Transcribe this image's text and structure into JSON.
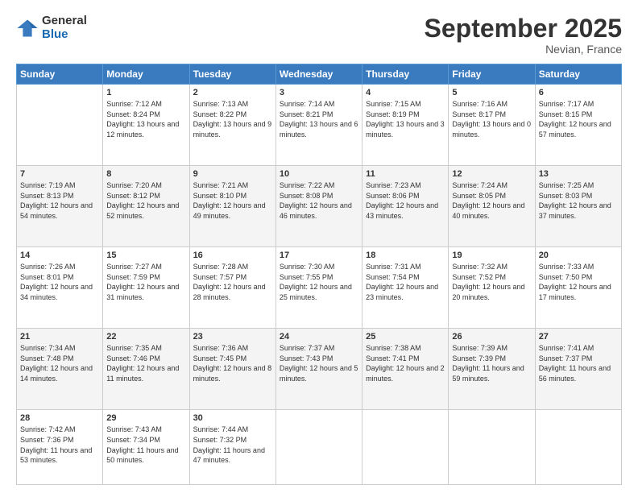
{
  "logo": {
    "general": "General",
    "blue": "Blue"
  },
  "header": {
    "month": "September 2025",
    "location": "Nevian, France"
  },
  "weekdays": [
    "Sunday",
    "Monday",
    "Tuesday",
    "Wednesday",
    "Thursday",
    "Friday",
    "Saturday"
  ],
  "weeks": [
    [
      {
        "day": "",
        "sunrise": "",
        "sunset": "",
        "daylight": ""
      },
      {
        "day": "1",
        "sunrise": "Sunrise: 7:12 AM",
        "sunset": "Sunset: 8:24 PM",
        "daylight": "Daylight: 13 hours and 12 minutes."
      },
      {
        "day": "2",
        "sunrise": "Sunrise: 7:13 AM",
        "sunset": "Sunset: 8:22 PM",
        "daylight": "Daylight: 13 hours and 9 minutes."
      },
      {
        "day": "3",
        "sunrise": "Sunrise: 7:14 AM",
        "sunset": "Sunset: 8:21 PM",
        "daylight": "Daylight: 13 hours and 6 minutes."
      },
      {
        "day": "4",
        "sunrise": "Sunrise: 7:15 AM",
        "sunset": "Sunset: 8:19 PM",
        "daylight": "Daylight: 13 hours and 3 minutes."
      },
      {
        "day": "5",
        "sunrise": "Sunrise: 7:16 AM",
        "sunset": "Sunset: 8:17 PM",
        "daylight": "Daylight: 13 hours and 0 minutes."
      },
      {
        "day": "6",
        "sunrise": "Sunrise: 7:17 AM",
        "sunset": "Sunset: 8:15 PM",
        "daylight": "Daylight: 12 hours and 57 minutes."
      }
    ],
    [
      {
        "day": "7",
        "sunrise": "Sunrise: 7:19 AM",
        "sunset": "Sunset: 8:13 PM",
        "daylight": "Daylight: 12 hours and 54 minutes."
      },
      {
        "day": "8",
        "sunrise": "Sunrise: 7:20 AM",
        "sunset": "Sunset: 8:12 PM",
        "daylight": "Daylight: 12 hours and 52 minutes."
      },
      {
        "day": "9",
        "sunrise": "Sunrise: 7:21 AM",
        "sunset": "Sunset: 8:10 PM",
        "daylight": "Daylight: 12 hours and 49 minutes."
      },
      {
        "day": "10",
        "sunrise": "Sunrise: 7:22 AM",
        "sunset": "Sunset: 8:08 PM",
        "daylight": "Daylight: 12 hours and 46 minutes."
      },
      {
        "day": "11",
        "sunrise": "Sunrise: 7:23 AM",
        "sunset": "Sunset: 8:06 PM",
        "daylight": "Daylight: 12 hours and 43 minutes."
      },
      {
        "day": "12",
        "sunrise": "Sunrise: 7:24 AM",
        "sunset": "Sunset: 8:05 PM",
        "daylight": "Daylight: 12 hours and 40 minutes."
      },
      {
        "day": "13",
        "sunrise": "Sunrise: 7:25 AM",
        "sunset": "Sunset: 8:03 PM",
        "daylight": "Daylight: 12 hours and 37 minutes."
      }
    ],
    [
      {
        "day": "14",
        "sunrise": "Sunrise: 7:26 AM",
        "sunset": "Sunset: 8:01 PM",
        "daylight": "Daylight: 12 hours and 34 minutes."
      },
      {
        "day": "15",
        "sunrise": "Sunrise: 7:27 AM",
        "sunset": "Sunset: 7:59 PM",
        "daylight": "Daylight: 12 hours and 31 minutes."
      },
      {
        "day": "16",
        "sunrise": "Sunrise: 7:28 AM",
        "sunset": "Sunset: 7:57 PM",
        "daylight": "Daylight: 12 hours and 28 minutes."
      },
      {
        "day": "17",
        "sunrise": "Sunrise: 7:30 AM",
        "sunset": "Sunset: 7:55 PM",
        "daylight": "Daylight: 12 hours and 25 minutes."
      },
      {
        "day": "18",
        "sunrise": "Sunrise: 7:31 AM",
        "sunset": "Sunset: 7:54 PM",
        "daylight": "Daylight: 12 hours and 23 minutes."
      },
      {
        "day": "19",
        "sunrise": "Sunrise: 7:32 AM",
        "sunset": "Sunset: 7:52 PM",
        "daylight": "Daylight: 12 hours and 20 minutes."
      },
      {
        "day": "20",
        "sunrise": "Sunrise: 7:33 AM",
        "sunset": "Sunset: 7:50 PM",
        "daylight": "Daylight: 12 hours and 17 minutes."
      }
    ],
    [
      {
        "day": "21",
        "sunrise": "Sunrise: 7:34 AM",
        "sunset": "Sunset: 7:48 PM",
        "daylight": "Daylight: 12 hours and 14 minutes."
      },
      {
        "day": "22",
        "sunrise": "Sunrise: 7:35 AM",
        "sunset": "Sunset: 7:46 PM",
        "daylight": "Daylight: 12 hours and 11 minutes."
      },
      {
        "day": "23",
        "sunrise": "Sunrise: 7:36 AM",
        "sunset": "Sunset: 7:45 PM",
        "daylight": "Daylight: 12 hours and 8 minutes."
      },
      {
        "day": "24",
        "sunrise": "Sunrise: 7:37 AM",
        "sunset": "Sunset: 7:43 PM",
        "daylight": "Daylight: 12 hours and 5 minutes."
      },
      {
        "day": "25",
        "sunrise": "Sunrise: 7:38 AM",
        "sunset": "Sunset: 7:41 PM",
        "daylight": "Daylight: 12 hours and 2 minutes."
      },
      {
        "day": "26",
        "sunrise": "Sunrise: 7:39 AM",
        "sunset": "Sunset: 7:39 PM",
        "daylight": "Daylight: 11 hours and 59 minutes."
      },
      {
        "day": "27",
        "sunrise": "Sunrise: 7:41 AM",
        "sunset": "Sunset: 7:37 PM",
        "daylight": "Daylight: 11 hours and 56 minutes."
      }
    ],
    [
      {
        "day": "28",
        "sunrise": "Sunrise: 7:42 AM",
        "sunset": "Sunset: 7:36 PM",
        "daylight": "Daylight: 11 hours and 53 minutes."
      },
      {
        "day": "29",
        "sunrise": "Sunrise: 7:43 AM",
        "sunset": "Sunset: 7:34 PM",
        "daylight": "Daylight: 11 hours and 50 minutes."
      },
      {
        "day": "30",
        "sunrise": "Sunrise: 7:44 AM",
        "sunset": "Sunset: 7:32 PM",
        "daylight": "Daylight: 11 hours and 47 minutes."
      },
      {
        "day": "",
        "sunrise": "",
        "sunset": "",
        "daylight": ""
      },
      {
        "day": "",
        "sunrise": "",
        "sunset": "",
        "daylight": ""
      },
      {
        "day": "",
        "sunrise": "",
        "sunset": "",
        "daylight": ""
      },
      {
        "day": "",
        "sunrise": "",
        "sunset": "",
        "daylight": ""
      }
    ]
  ]
}
